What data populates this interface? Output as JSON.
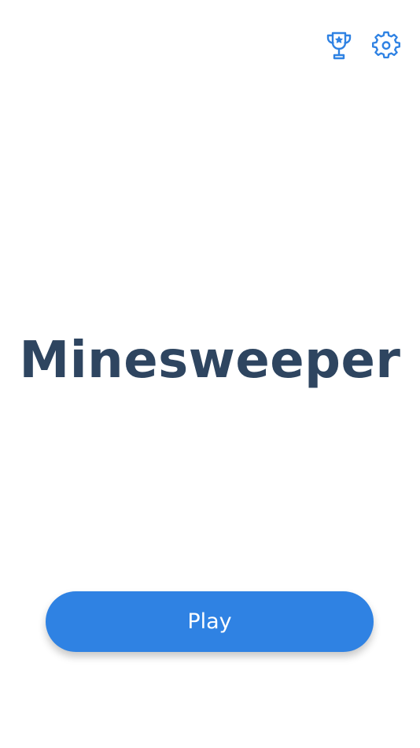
{
  "header": {
    "actions": [
      {
        "icon": "trophy-icon"
      },
      {
        "icon": "gear-icon"
      }
    ]
  },
  "main": {
    "title": "Minesweeper",
    "play_label": "Play"
  },
  "colors": {
    "accent": "#2f82e3",
    "title": "#2e4560",
    "background": "#ffffff"
  }
}
